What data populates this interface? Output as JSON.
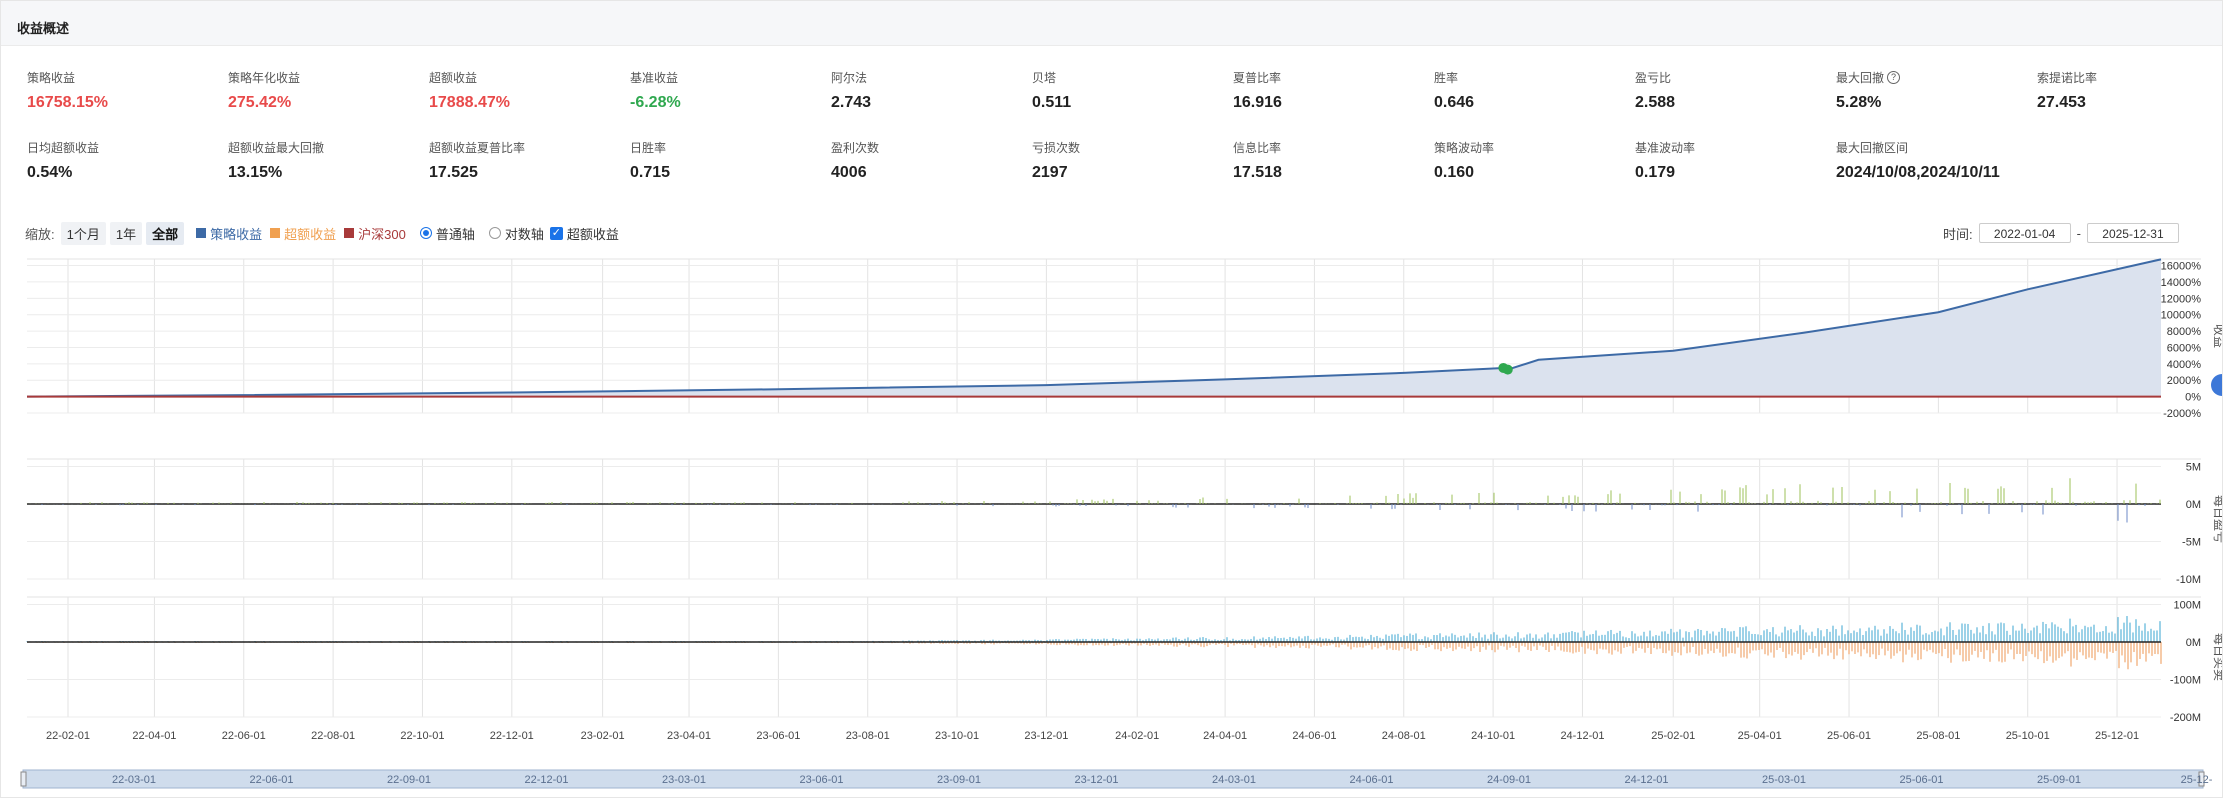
{
  "header": {
    "title": "收益概述"
  },
  "stats": [
    {
      "label": "策略收益",
      "value": "16758.15%",
      "color": "#e84a4a"
    },
    {
      "label": "策略年化收益",
      "value": "275.42%",
      "color": "#e84a4a"
    },
    {
      "label": "超额收益",
      "value": "17888.47%",
      "color": "#e84a4a"
    },
    {
      "label": "基准收益",
      "value": "-6.28%",
      "color": "#2fa84f"
    },
    {
      "label": "阿尔法",
      "value": "2.743"
    },
    {
      "label": "贝塔",
      "value": "0.511"
    },
    {
      "label": "夏普比率",
      "value": "16.916"
    },
    {
      "label": "胜率",
      "value": "0.646"
    },
    {
      "label": "盈亏比",
      "value": "2.588"
    },
    {
      "label": "最大回撤",
      "value": "5.28%",
      "help": "?"
    },
    {
      "label": "索提诺比率",
      "value": "27.453"
    },
    {
      "label": "日均超额收益",
      "value": "0.54%"
    },
    {
      "label": "超额收益最大回撤",
      "value": "13.15%"
    },
    {
      "label": "超额收益夏普比率",
      "value": "17.525"
    },
    {
      "label": "日胜率",
      "value": "0.715"
    },
    {
      "label": "盈利次数",
      "value": "4006"
    },
    {
      "label": "亏损次数",
      "value": "2197"
    },
    {
      "label": "信息比率",
      "value": "17.518"
    },
    {
      "label": "策略波动率",
      "value": "0.160"
    },
    {
      "label": "基准波动率",
      "value": "0.179"
    },
    {
      "label": "最大回撤区间",
      "value": "2024/10/08,2024/10/11"
    }
  ],
  "toolbar": {
    "zoom_label": "缩放:",
    "zoom_buttons": [
      "1个月",
      "1年",
      "全部"
    ],
    "zoom_active": "全部",
    "legend": [
      {
        "label": "策略收益",
        "color": "#3d6aa6"
      },
      {
        "label": "超额收益",
        "color": "#f0a050"
      },
      {
        "label": "沪深300",
        "color": "#a83a3a"
      }
    ],
    "axis_normal": "普通轴",
    "axis_log": "对数轴",
    "excess_toggle": "超额收益",
    "time_label": "时间:",
    "start_date": "2022-01-04",
    "end_date": "2025-12-31",
    "date_sep": "-"
  },
  "chart_data": [
    {
      "type": "area",
      "ylabel": "收益",
      "yticks": [
        "16000%",
        "14000%",
        "12000%",
        "10000%",
        "8000%",
        "6000%",
        "4000%",
        "2000%",
        "0%",
        "-2000%"
      ],
      "ylim": [
        -2000,
        16800
      ],
      "series": [
        {
          "name": "策略收益",
          "color": "#3d6aa6",
          "x": [
            "2022-01-04",
            "2022-06-01",
            "2022-12-01",
            "2023-06-01",
            "2023-12-01",
            "2024-04-01",
            "2024-08-01",
            "2024-10-08",
            "2024-10-11",
            "2024-11-01",
            "2025-02-01",
            "2025-05-01",
            "2025-08-01",
            "2025-10-01",
            "2025-12-31"
          ],
          "values": [
            0,
            180,
            500,
            900,
            1400,
            2100,
            2900,
            3500,
            3300,
            4500,
            5600,
            7800,
            10300,
            13100,
            16758
          ]
        },
        {
          "name": "沪深300",
          "color": "#a83a3a",
          "x": [
            "2022-01-04",
            "2025-12-31"
          ],
          "values": [
            0,
            -6
          ]
        }
      ]
    },
    {
      "type": "bar",
      "ylabel": "每日盈亏",
      "yticks": [
        "5M",
        "0M",
        "-5M",
        "-10M"
      ],
      "ylim": [
        -10,
        6
      ]
    },
    {
      "type": "bar",
      "ylabel": "每日买卖",
      "yticks": [
        "100M",
        "0M",
        "-100M",
        "-200M"
      ],
      "ylim": [
        -200,
        120
      ]
    }
  ],
  "xaxis_ticks": [
    "22-02-01",
    "22-04-01",
    "22-06-01",
    "22-08-01",
    "22-10-01",
    "22-12-01",
    "23-02-01",
    "23-04-01",
    "23-06-01",
    "23-08-01",
    "23-10-01",
    "23-12-01",
    "24-02-01",
    "24-04-01",
    "24-06-01",
    "24-08-01",
    "24-10-01",
    "24-12-01",
    "25-02-01",
    "25-04-01",
    "25-06-01",
    "25-08-01",
    "25-10-01",
    "25-12-01"
  ],
  "navigator_ticks": [
    "22-03-01",
    "22-06-01",
    "22-09-01",
    "22-12-01",
    "23-03-01",
    "23-06-01",
    "23-09-01",
    "23-12-01",
    "24-03-01",
    "24-06-01",
    "24-09-01",
    "24-12-01",
    "25-03-01",
    "25-06-01",
    "25-09-01",
    "25-12-"
  ]
}
